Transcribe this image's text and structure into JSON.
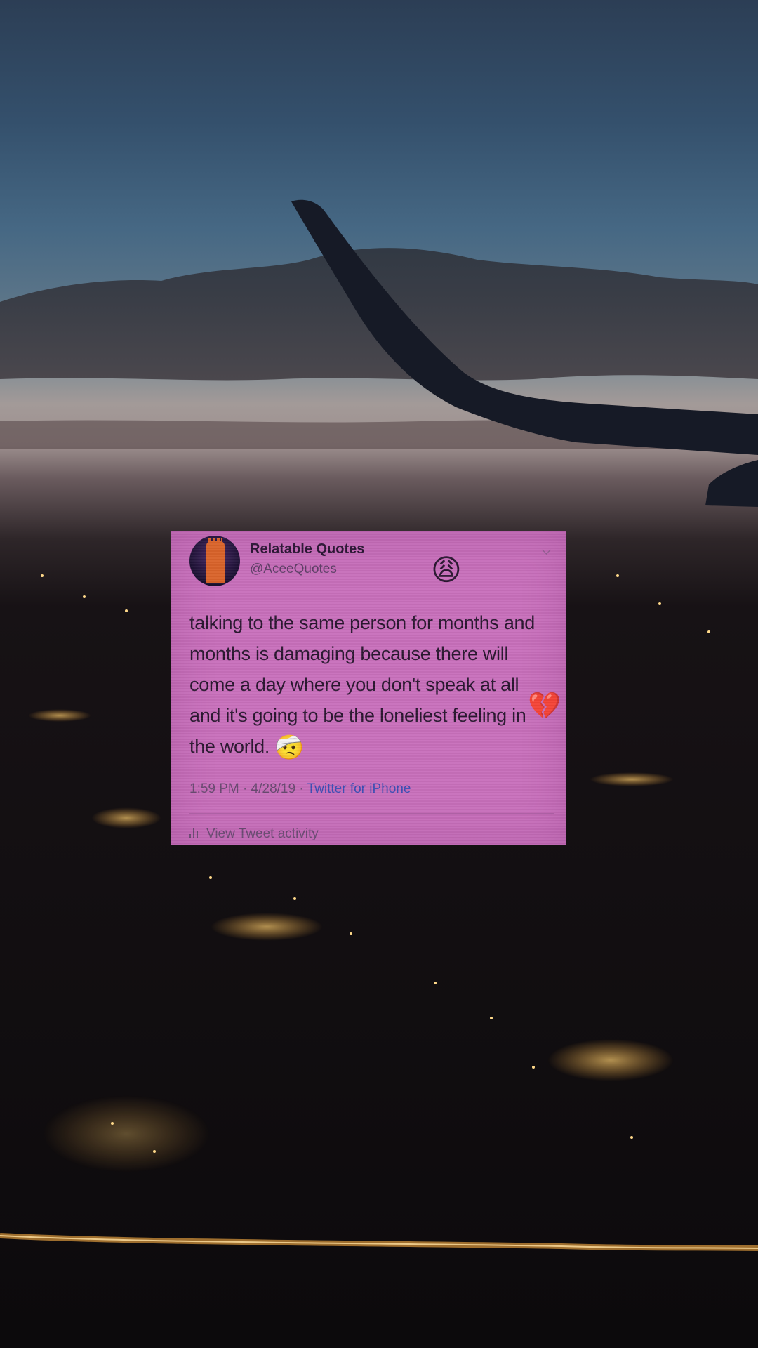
{
  "tweet": {
    "display_name": "Relatable Quotes",
    "handle": "@AceeQuotes",
    "header_emoji": "😩",
    "text_before_emoji": "talking to the same person for months and months is damaging because there will come a day where you don't speak at all and it's going to be the loneliest feeling in the world.",
    "inline_emoji": "🤕",
    "side_emoji": "💔",
    "time": "1:59 PM",
    "date": "4/28/19",
    "source": "Twitter for iPhone",
    "separator": " · ",
    "activity_label": "View Tweet activity"
  },
  "colors": {
    "card_background": "#c86fbb",
    "link": "#3c4eb5"
  },
  "icons": [
    "avatar",
    "chevron-down-icon",
    "bar-chart-icon"
  ]
}
